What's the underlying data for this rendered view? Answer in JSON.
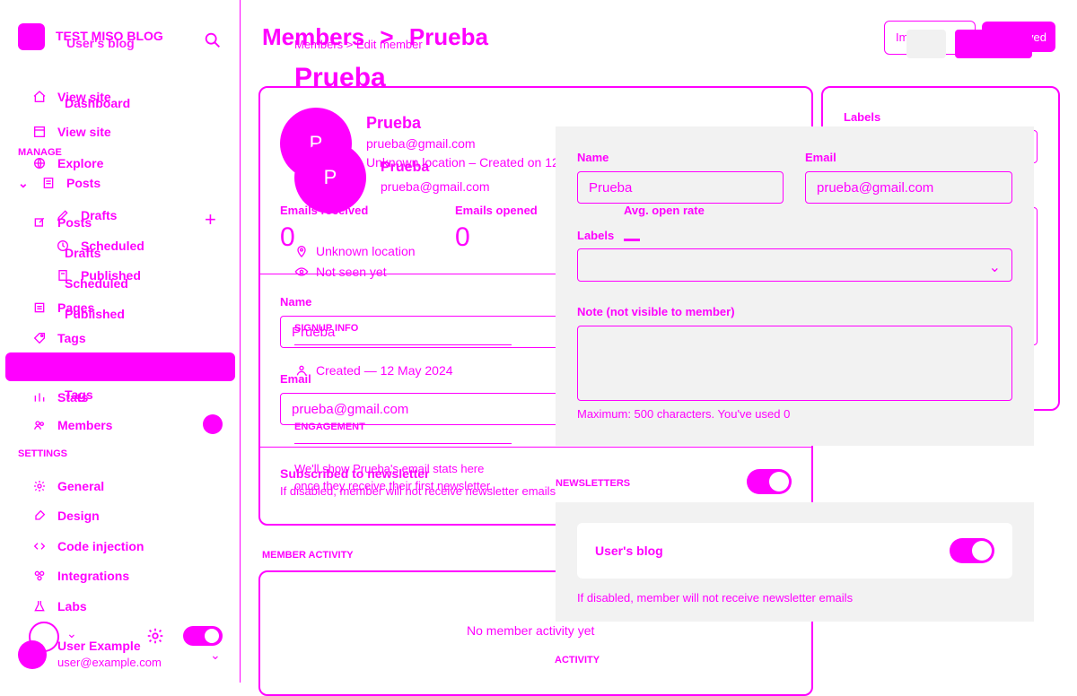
{
  "sidebar": {
    "site_name": "TEST MISO BLOG",
    "site_subtitle": "User's blog",
    "nav": [
      {
        "label": "View site",
        "icon": "home-icon"
      },
      {
        "label": "Dashboard",
        "icon": "dashboard-icon"
      },
      {
        "label": "View site",
        "icon": "window-icon"
      },
      {
        "label": "Explore",
        "icon": "globe-icon"
      },
      {
        "label": "Posts",
        "icon": "posts-icon"
      },
      {
        "label": "Drafts",
        "icon": "pencil-icon"
      },
      {
        "label": "Scheduled",
        "icon": "clock-icon"
      },
      {
        "label": "Published",
        "icon": "doc-icon"
      },
      {
        "label": "Pages",
        "icon": "pages-icon"
      },
      {
        "label": "Tags",
        "icon": "tag-icon"
      },
      {
        "label": "Members",
        "icon": "members-icon"
      }
    ],
    "manage_label": "MANAGE",
    "settings_label": "SETTINGS",
    "settings": [
      {
        "label": "General",
        "icon": "gear-icon"
      },
      {
        "label": "Design",
        "icon": "brush-icon"
      },
      {
        "label": "Code injection",
        "icon": "code-icon"
      },
      {
        "label": "Integrations",
        "icon": "integrations-icon"
      },
      {
        "label": "Labs",
        "icon": "flask-icon"
      }
    ],
    "user": {
      "name": "User Example",
      "email": "user@example.com"
    },
    "posts_sub": [
      "Posts",
      "Drafts",
      "Scheduled",
      "Published"
    ],
    "stats_label": "Stats",
    "tags_label": "Tags"
  },
  "header": {
    "breadcrumb_big": "Members",
    "breadcrumb_arrow": ">",
    "breadcrumb_big_right": "Prueba",
    "breadcrumb_small": "Members > Edit member",
    "title": "Prueba",
    "actions": {
      "import": "Import",
      "save": "Saved",
      "more": "..."
    }
  },
  "member": {
    "initial": "P",
    "name": "Prueba",
    "email": "prueba@gmail.com",
    "meta": "Unknown location – Created on 12 May 2024",
    "stats": {
      "emails_received_label": "Emails received",
      "emails_received": "0",
      "emails_opened_label": "Emails opened",
      "emails_opened": "0",
      "avg_open_rate_label": "Avg. open rate"
    },
    "location": "Unknown location",
    "seen": "Not seen yet",
    "signup_info_label": "SIGNUP INFO",
    "created": "Created — 12 May 2024",
    "engagement_label": "ENGAGEMENT",
    "engagement_text": "We'll show Prueba's email stats here once they receive their first newsletter.",
    "newsletter_label": "Subscribed to newsletter",
    "newsletter_help": "If disabled, member will not receive newsletter emails"
  },
  "form": {
    "name_label": "Name",
    "name_value": "Prueba",
    "email_label": "Email",
    "email_value": "prueba@gmail.com",
    "labels_label": "Labels",
    "note_label": "Note (not visible to member)",
    "note_help": "Maximum: 500 characters. You've used 0"
  },
  "newsletters": {
    "title": "NEWSLETTERS",
    "item": "User's blog",
    "help": "If disabled, member will not receive newsletter emails"
  },
  "activity": {
    "member_activity_label": "MEMBER ACTIVITY",
    "empty": "No member activity yet",
    "activity_label": "ACTIVITY"
  },
  "colors": {
    "accent": "#ff00ff",
    "panel": "#f2f2f2"
  }
}
